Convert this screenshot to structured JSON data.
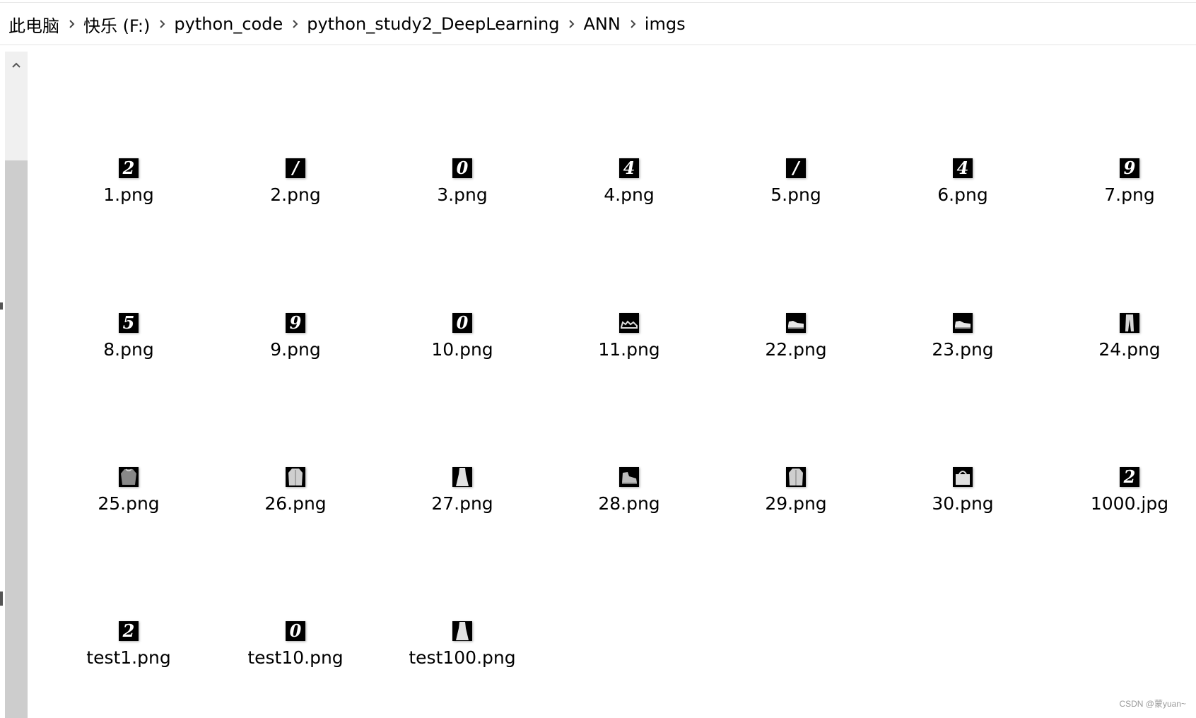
{
  "breadcrumb": {
    "items": [
      "此电脑",
      "快乐 (F:)",
      "python_code",
      "python_study2_DeepLearning",
      "ANN",
      "imgs"
    ],
    "separator_icon": "chevron-right-icon"
  },
  "scrollbar": {
    "up_icon": "chevron-up-icon"
  },
  "files": [
    {
      "name": "1.png",
      "thumb": "digit",
      "glyph": "2"
    },
    {
      "name": "2.png",
      "thumb": "digit",
      "glyph": "/"
    },
    {
      "name": "3.png",
      "thumb": "digit",
      "glyph": "0"
    },
    {
      "name": "4.png",
      "thumb": "digit",
      "glyph": "4"
    },
    {
      "name": "5.png",
      "thumb": "digit",
      "glyph": "/"
    },
    {
      "name": "6.png",
      "thumb": "digit",
      "glyph": "4"
    },
    {
      "name": "7.png",
      "thumb": "digit",
      "glyph": "9"
    },
    {
      "name": "8.png",
      "thumb": "digit",
      "glyph": "5"
    },
    {
      "name": "9.png",
      "thumb": "digit",
      "glyph": "9"
    },
    {
      "name": "10.png",
      "thumb": "digit",
      "glyph": "0"
    },
    {
      "name": "11.png",
      "thumb": "sandal",
      "glyph": ""
    },
    {
      "name": "22.png",
      "thumb": "sneaker",
      "glyph": ""
    },
    {
      "name": "23.png",
      "thumb": "sneaker",
      "glyph": ""
    },
    {
      "name": "24.png",
      "thumb": "trouser",
      "glyph": ""
    },
    {
      "name": "25.png",
      "thumb": "pullover",
      "glyph": ""
    },
    {
      "name": "26.png",
      "thumb": "coat",
      "glyph": ""
    },
    {
      "name": "27.png",
      "thumb": "dress",
      "glyph": ""
    },
    {
      "name": "28.png",
      "thumb": "boot",
      "glyph": ""
    },
    {
      "name": "29.png",
      "thumb": "coat",
      "glyph": ""
    },
    {
      "name": "30.png",
      "thumb": "bag",
      "glyph": ""
    },
    {
      "name": "1000.jpg",
      "thumb": "digit",
      "glyph": "2"
    },
    {
      "name": "test1.png",
      "thumb": "digit",
      "glyph": "2"
    },
    {
      "name": "test10.png",
      "thumb": "digit",
      "glyph": "0"
    },
    {
      "name": "test100.png",
      "thumb": "dress",
      "glyph": ""
    }
  ],
  "watermark": "CSDN @蒙yuan~"
}
